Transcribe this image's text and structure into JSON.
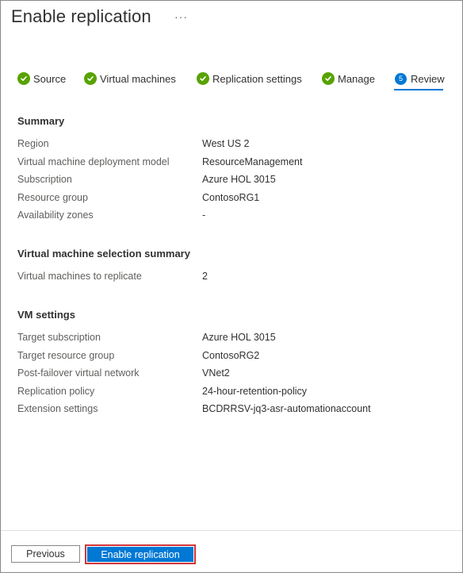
{
  "header": {
    "title": "Enable replication",
    "more_label": "···"
  },
  "steps": [
    {
      "label": "Source",
      "status": "complete",
      "icon": "check-circle-icon"
    },
    {
      "label": "Virtual machines",
      "status": "complete",
      "icon": "check-circle-icon"
    },
    {
      "label": "Replication settings",
      "status": "complete",
      "icon": "check-circle-icon"
    },
    {
      "label": "Manage",
      "status": "complete",
      "icon": "check-circle-icon"
    },
    {
      "label": "Review",
      "status": "active",
      "number": "5"
    }
  ],
  "summary": {
    "heading": "Summary",
    "rows": [
      {
        "key": "Region",
        "value": "West US 2"
      },
      {
        "key": "Virtual machine deployment model",
        "value": "ResourceManagement"
      },
      {
        "key": "Subscription",
        "value": "Azure HOL 3015"
      },
      {
        "key": "Resource group",
        "value": "ContosoRG1"
      },
      {
        "key": "Availability zones",
        "value": "-"
      }
    ]
  },
  "vm_selection": {
    "heading": "Virtual machine selection summary",
    "rows": [
      {
        "key": "Virtual machines to replicate",
        "value": "2"
      }
    ]
  },
  "vm_settings": {
    "heading": "VM settings",
    "rows": [
      {
        "key": "Target subscription",
        "value": "Azure HOL 3015"
      },
      {
        "key": "Target resource group",
        "value": "ContosoRG2"
      },
      {
        "key": "Post-failover virtual network",
        "value": "VNet2"
      },
      {
        "key": "Replication policy",
        "value": "24-hour-retention-policy"
      },
      {
        "key": "Extension settings",
        "value": "BCDRRSV-jq3-asr-automationaccount"
      }
    ]
  },
  "footer": {
    "previous_label": "Previous",
    "primary_label": "Enable replication"
  },
  "colors": {
    "accent": "#0078d4",
    "success": "#57a300",
    "highlight": "#d13438"
  }
}
